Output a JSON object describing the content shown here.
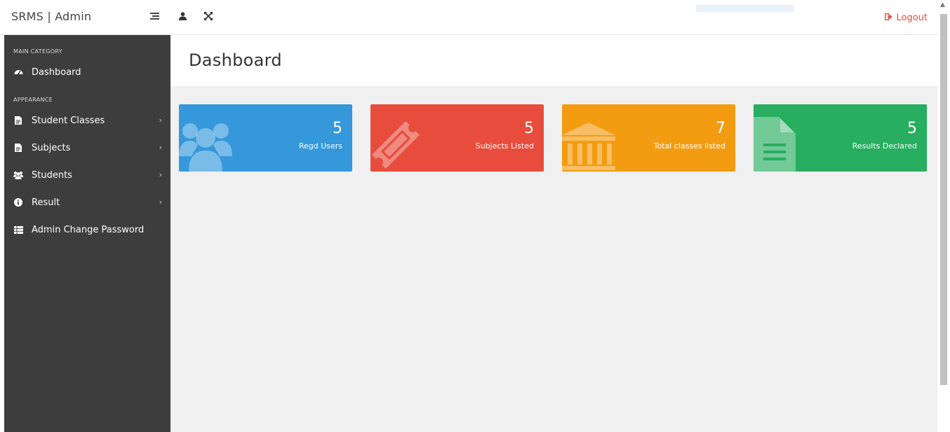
{
  "app": {
    "brand": "SRMS | Admin"
  },
  "topbar": {
    "icons": [
      "menu-lines-icon",
      "user-icon",
      "expand-icon"
    ],
    "logout_label": "Logout",
    "logout_icon": "sign-out-icon"
  },
  "sidebar": {
    "main_category": "MAIN CATEGORY",
    "appearance": "APPEARANCE",
    "items": [
      {
        "label": "Dashboard",
        "icon": "dashboard-icon",
        "has_children": false
      },
      {
        "label": "Student Classes",
        "icon": "file-icon",
        "has_children": true
      },
      {
        "label": "Subjects",
        "icon": "file-icon",
        "has_children": true
      },
      {
        "label": "Students",
        "icon": "users-icon",
        "has_children": true
      },
      {
        "label": "Result",
        "icon": "info-icon",
        "has_children": true
      },
      {
        "label": "Admin Change Password",
        "icon": "table-icon",
        "has_children": false
      }
    ],
    "chevron": "›"
  },
  "main": {
    "title": "Dashboard",
    "stats": [
      {
        "number": "5",
        "label": "Regd Users",
        "color": "#3498db",
        "icon": "users-icon"
      },
      {
        "number": "5",
        "label": "Subjects Listed",
        "color": "#e74c3c",
        "icon": "ticket-icon"
      },
      {
        "number": "7",
        "label": "Total classes listed",
        "color": "#f39c12",
        "icon": "bank-icon"
      },
      {
        "number": "5",
        "label": "Results Declared",
        "color": "#27ae60",
        "icon": "document-icon"
      }
    ]
  }
}
